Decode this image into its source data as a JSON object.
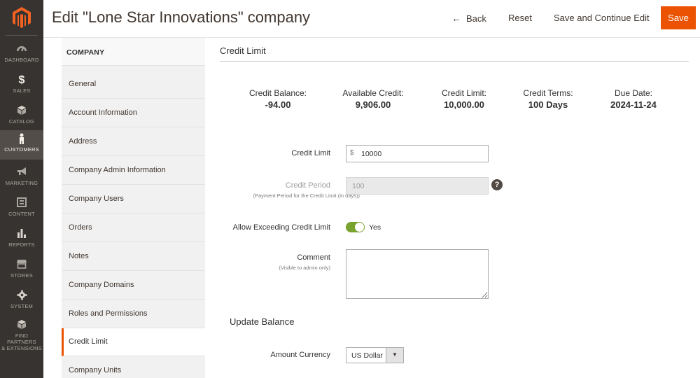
{
  "nav": {
    "items": [
      {
        "label": "DASHBOARD",
        "icon": "dashboard-icon"
      },
      {
        "label": "SALES",
        "icon": "dollar-icon"
      },
      {
        "label": "CATALOG",
        "icon": "box-icon"
      },
      {
        "label": "CUSTOMERS",
        "icon": "person-icon"
      },
      {
        "label": "MARKETING",
        "icon": "megaphone-icon"
      },
      {
        "label": "CONTENT",
        "icon": "layout-icon"
      },
      {
        "label": "REPORTS",
        "icon": "bar-chart-icon"
      },
      {
        "label": "STORES",
        "icon": "storefront-icon"
      },
      {
        "label": "SYSTEM",
        "icon": "gear-icon"
      },
      {
        "label_line1": "FIND PARTNERS",
        "label_line2": "& EXTENSIONS",
        "icon": "box-icon"
      }
    ],
    "active": "CUSTOMERS"
  },
  "header": {
    "title": "Edit \"Lone Star Innovations\" company",
    "back_label": "Back",
    "reset_label": "Reset",
    "save_continue_label": "Save and Continue Edit",
    "save_label": "Save"
  },
  "tabs": {
    "heading": "COMPANY",
    "items": [
      "General",
      "Account Information",
      "Address",
      "Company Admin Information",
      "Company Users",
      "Orders",
      "Notes",
      "Company Domains",
      "Roles and Permissions",
      "Credit Limit",
      "Company Units"
    ],
    "active": "Credit Limit"
  },
  "credit": {
    "section_title": "Credit Limit",
    "stats": [
      {
        "label": "Credit Balance:",
        "value": "-94.00"
      },
      {
        "label": "Available Credit:",
        "value": "9,906.00"
      },
      {
        "label": "Credit Limit:",
        "value": "10,000.00"
      },
      {
        "label": "Credit Terms:",
        "value": "100 Days"
      },
      {
        "label": "Due Date:",
        "value": "2024-11-24"
      }
    ],
    "credit_limit_label": "Credit Limit",
    "currency_symbol": "$",
    "credit_limit_value": "10000",
    "credit_period_label": "Credit Period",
    "credit_period_note": "(Payment Period for the Credit Limit (in days))",
    "credit_period_value": "100",
    "allow_exceeding_label": "Allow Exceeding Credit Limit",
    "allow_exceeding_value": "Yes",
    "comment_label": "Comment",
    "comment_note": "(Visible to admin only)",
    "update_balance_title": "Update Balance",
    "amount_currency_label": "Amount Currency",
    "amount_currency_value": "US Dollar"
  },
  "colors": {
    "accent": "#eb5202",
    "toggle_on": "#79a22e",
    "nav_bg": "#373330"
  }
}
